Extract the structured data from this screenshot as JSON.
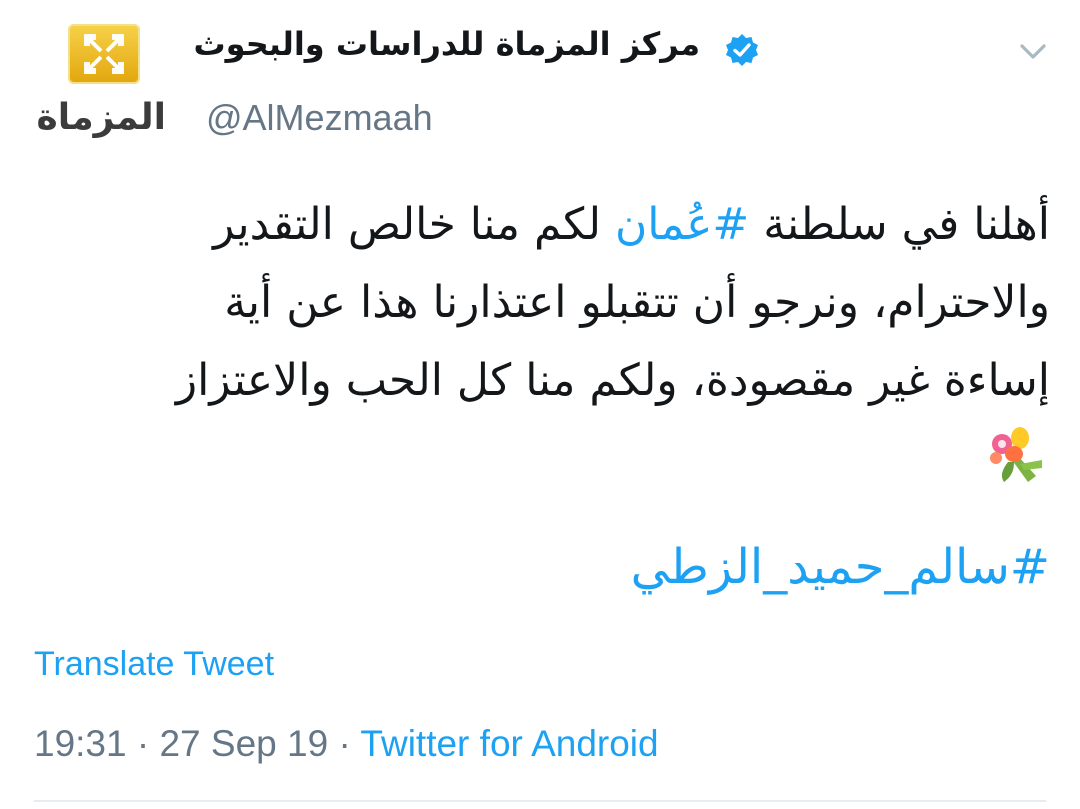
{
  "account": {
    "display_name": "مركز المزماة للدراسات والبحوث",
    "handle": "@AlMezmaah",
    "logo_text": "المزماة",
    "verified": true
  },
  "tweet": {
    "line1_part1": "أهلنا في سلطنة ",
    "line1_hashtag": "#عُمان",
    "line1_part2": " لكم منا خالص التقدير",
    "line2": "والاحترام، ونرجو أن تتقبلو اعتذارنا هذا عن أية",
    "line3": "إساءة غير مقصودة، ولكم منا كل الحب والاعتزاز",
    "emoji": "bouquet-icon",
    "hashtag": "#سالم_حميد_الزطي"
  },
  "actions": {
    "translate": "Translate Tweet"
  },
  "meta": {
    "time": "19:31",
    "separator": " · ",
    "date": "27 Sep 19",
    "client": "Twitter for Android"
  },
  "colors": {
    "link": "#1da1f2",
    "muted": "#657786",
    "text": "#14171a"
  }
}
